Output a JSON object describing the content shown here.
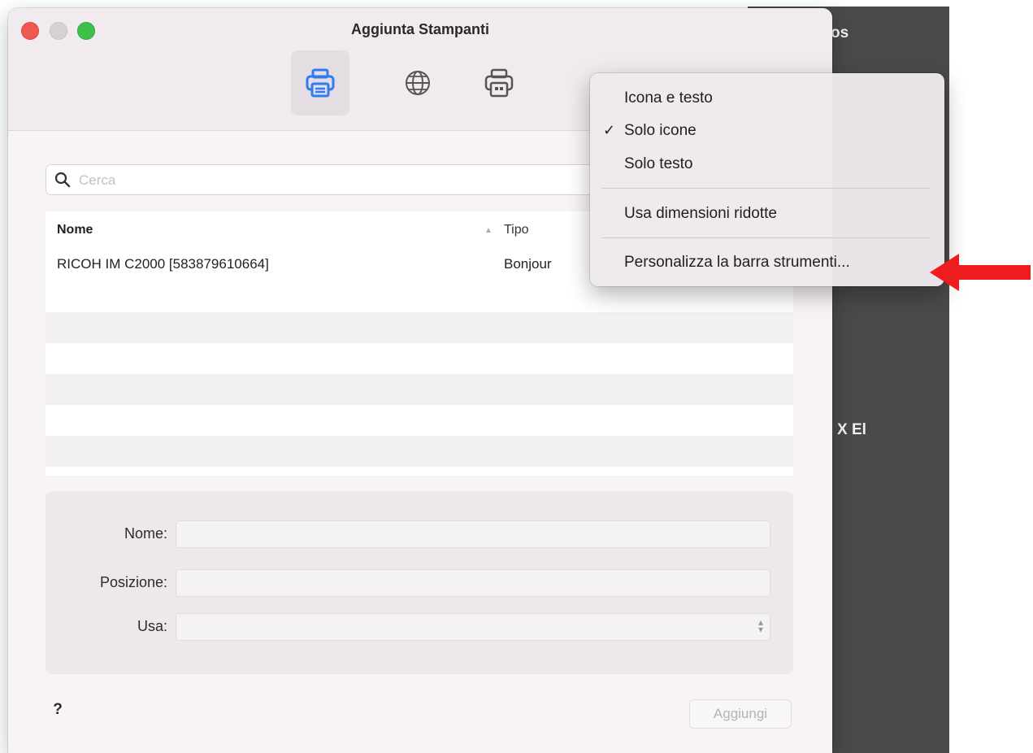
{
  "background": {
    "right_text_top": "os",
    "right_text_mid": "X El",
    "color": "#4a4a4a"
  },
  "window": {
    "title": "Aggiunta Stampanti"
  },
  "toolbar": {
    "items": [
      "default-printer",
      "ip-printer",
      "windows-printer"
    ],
    "accent": "#2f7bf5"
  },
  "search": {
    "placeholder": "Cerca",
    "value": ""
  },
  "table": {
    "columns": [
      "Nome",
      "Tipo"
    ],
    "rows": [
      {
        "name": "RICOH IM C2000 [583879610664]",
        "type": "Bonjour"
      }
    ]
  },
  "form": {
    "name_label": "Nome:",
    "location_label": "Posizione:",
    "use_label": "Usa:",
    "name_value": "",
    "location_value": "",
    "use_value": ""
  },
  "footer": {
    "help": "?",
    "add_button": "Aggiungi"
  },
  "context_menu": {
    "items": [
      {
        "label": "Icona e testo",
        "checked": false
      },
      {
        "label": "Solo icone",
        "checked": true
      },
      {
        "label": "Solo testo",
        "checked": false
      },
      {
        "label": "Usa dimensioni ridotte",
        "checked": false
      },
      {
        "label": "Personalizza la barra strumenti...",
        "checked": false
      }
    ],
    "check_mark": "✓"
  },
  "annotation": {
    "arrow_color": "#ee1c1c"
  }
}
